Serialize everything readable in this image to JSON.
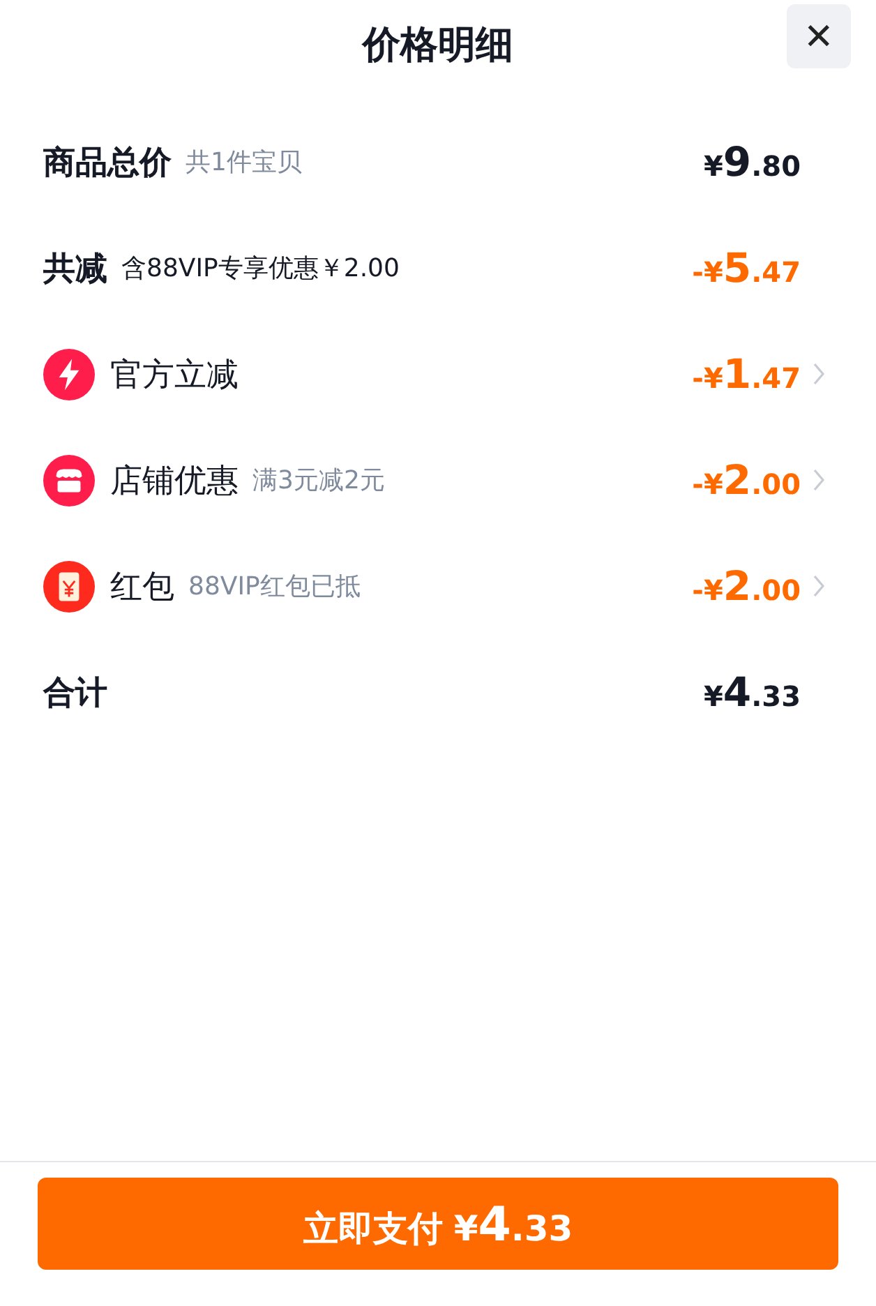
{
  "header": {
    "title": "价格明细",
    "close": "✕"
  },
  "rows": [
    {
      "kind": "summary",
      "label": "商品总价",
      "note": "共1件宝贝",
      "negative": false,
      "amount": {
        "sign": "¥",
        "int": "9",
        "dec": ".80"
      }
    },
    {
      "kind": "summary",
      "label": "共减",
      "note": "含88VIP专享优惠￥2.00",
      "negative": true,
      "amount": {
        "sign": "-¥",
        "int": "5",
        "dec": ".47"
      }
    },
    {
      "kind": "discount",
      "label": "官方立减",
      "negative": true,
      "amount": {
        "sign": "-¥",
        "int": "1",
        "dec": ".47"
      }
    },
    {
      "kind": "discount",
      "label": "店铺优惠",
      "note": "满3元减2元",
      "negative": true,
      "amount": {
        "sign": "-¥",
        "int": "2",
        "dec": ".00"
      }
    },
    {
      "kind": "discount",
      "label": "红包",
      "note": "88VIP红包已抵",
      "negative": true,
      "amount": {
        "sign": "-¥",
        "int": "2",
        "dec": ".00"
      }
    },
    {
      "kind": "summary",
      "label": "合计",
      "negative": false,
      "amount": {
        "sign": "¥",
        "int": "4",
        "dec": ".33"
      }
    }
  ],
  "pay_button": {
    "label": "立即支付",
    "amount": {
      "sign": "¥",
      "int": "4",
      "dec": ".33"
    }
  }
}
